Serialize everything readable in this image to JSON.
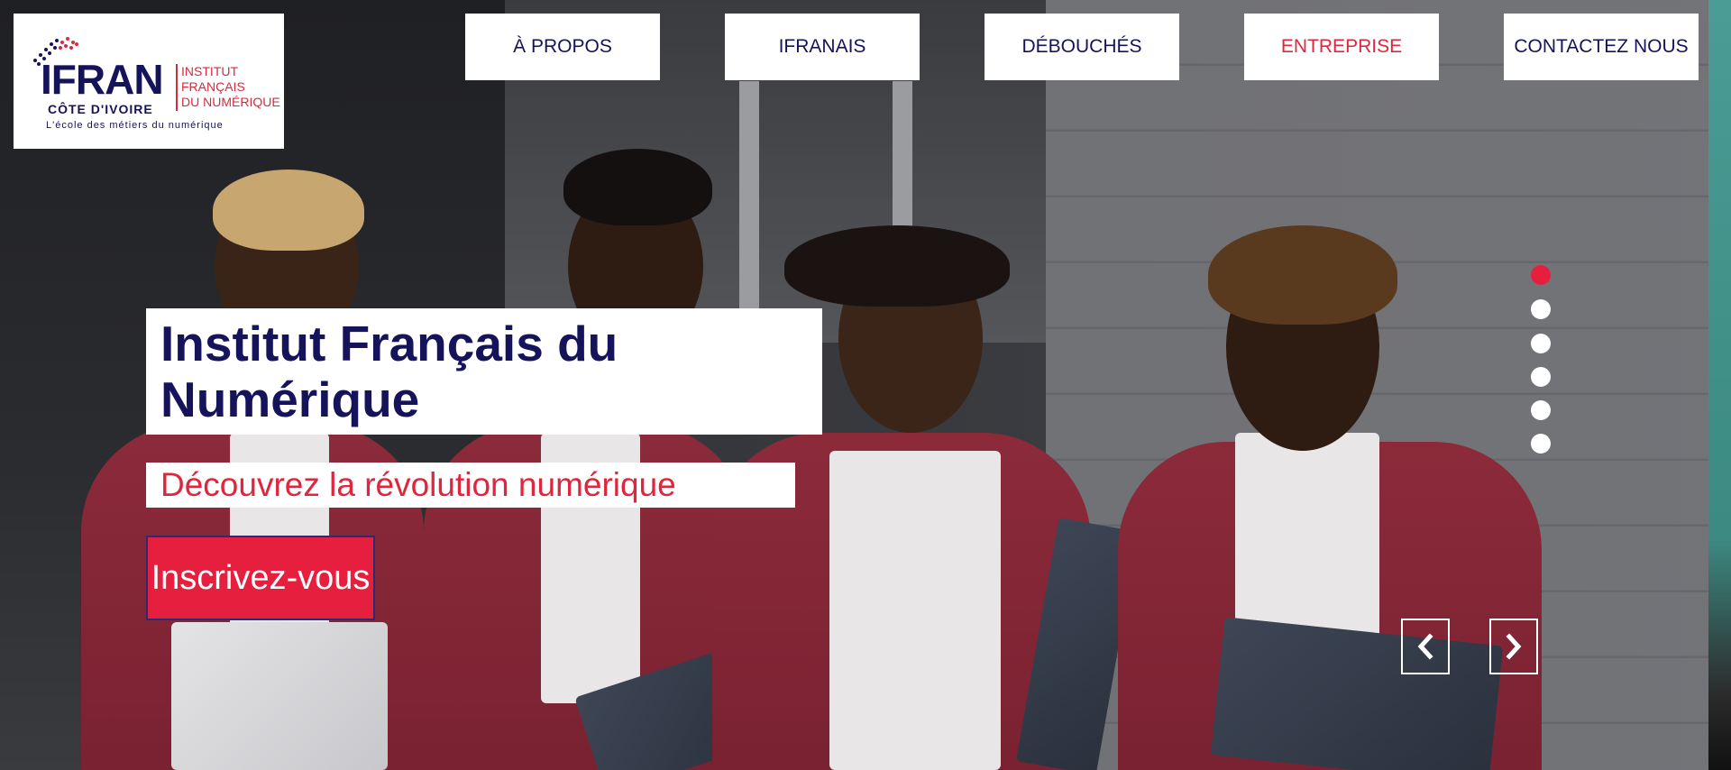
{
  "logo": {
    "main": "IFRAN",
    "side_line1": "INSTITUT",
    "side_line2": "FRANÇAIS",
    "side_line3": "DU NUMÉRIQUE",
    "country": "CÔTE D'IVOIRE",
    "tagline": "L'école des métiers du numérique"
  },
  "nav": {
    "items": [
      {
        "label": "À PROPOS",
        "active": false
      },
      {
        "label": "IFRANAIS",
        "active": false
      },
      {
        "label": "DÉBOUCHÉS",
        "active": false
      },
      {
        "label": "ENTREPRISE",
        "active": true
      },
      {
        "label": "CONTACTEZ NOUS",
        "active": false
      }
    ]
  },
  "hero": {
    "title_line1": "Institut Français du",
    "title_line2": "Numérique",
    "subtitle": "Découvrez la révolution numérique",
    "cta_label": "Inscrivez-vous"
  },
  "slider": {
    "slide_count": 6,
    "active_slide": 1,
    "prev_icon": "chevron-left-icon",
    "next_icon": "chevron-right-icon"
  },
  "colors": {
    "brand_navy": "#15135a",
    "brand_red": "#e0263e",
    "cta_red": "#e61f3e",
    "jacket": "#8c2a3a"
  }
}
